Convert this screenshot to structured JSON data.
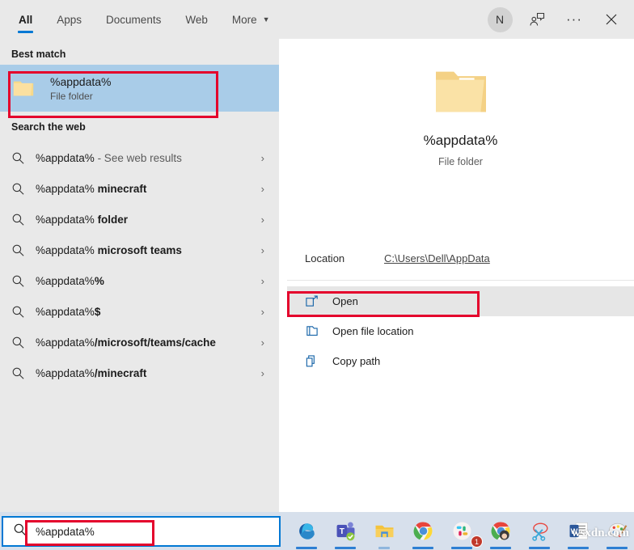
{
  "header": {
    "tabs": [
      {
        "label": "All",
        "active": true
      },
      {
        "label": "Apps",
        "active": false
      },
      {
        "label": "Documents",
        "active": false
      },
      {
        "label": "Web",
        "active": false
      },
      {
        "label": "More",
        "active": false,
        "caret": "▼"
      }
    ],
    "avatar_initial": "N",
    "feedback_icon": "feedback-person-icon",
    "more_icon": "···",
    "close_icon": "✕"
  },
  "left": {
    "best_match_title": "Best match",
    "best_match": {
      "name": "%appdata%",
      "type": "File folder",
      "icon": "folder-icon"
    },
    "search_web_title": "Search the web",
    "web_results": [
      {
        "query": "%appdata%",
        "suffix": " - See web results",
        "suffix_style": "dim"
      },
      {
        "query": "%appdata% ",
        "suffix": "minecraft",
        "suffix_style": "bold"
      },
      {
        "query": "%appdata% ",
        "suffix": "folder",
        "suffix_style": "bold"
      },
      {
        "query": "%appdata% ",
        "suffix": "microsoft teams",
        "suffix_style": "bold"
      },
      {
        "query": "%appdata%",
        "suffix": "%",
        "suffix_style": "bold"
      },
      {
        "query": "%appdata%",
        "suffix": "$",
        "suffix_style": "bold"
      },
      {
        "query": "%appdata%",
        "suffix": "/microsoft/teams/cache",
        "suffix_style": "bold"
      },
      {
        "query": "%appdata%",
        "suffix": "/minecraft",
        "suffix_style": "bold"
      }
    ],
    "chevron": "›"
  },
  "right": {
    "preview_title": "%appdata%",
    "preview_subtitle": "File folder",
    "location_label": "Location",
    "location_value": "C:\\Users\\Dell\\AppData",
    "actions": [
      {
        "label": "Open",
        "icon": "open-window-icon",
        "highlighted": true
      },
      {
        "label": "Open file location",
        "icon": "open-file-location-icon",
        "highlighted": false
      },
      {
        "label": "Copy path",
        "icon": "copy-path-icon",
        "highlighted": false
      }
    ]
  },
  "taskbar": {
    "search_value": "%appdata%",
    "search_icon": "search-icon",
    "apps": [
      {
        "name": "microsoft-edge",
        "badge": null
      },
      {
        "name": "microsoft-teams",
        "badge": null
      },
      {
        "name": "file-explorer",
        "badge": null
      },
      {
        "name": "google-chrome",
        "badge": null
      },
      {
        "name": "slack",
        "badge": "1"
      },
      {
        "name": "google-chrome-profile",
        "badge": null
      },
      {
        "name": "snipping-tool",
        "badge": null
      },
      {
        "name": "microsoft-word",
        "badge": null
      },
      {
        "name": "paint",
        "badge": null
      }
    ],
    "watermark": "wsxdn.com"
  },
  "colors": {
    "accent_blue": "#0078d4",
    "selection_blue": "#a9cce8",
    "annotation_red": "#e4032c",
    "panel_gray": "#e9e9e9",
    "taskbar": "#d7e0ec"
  }
}
